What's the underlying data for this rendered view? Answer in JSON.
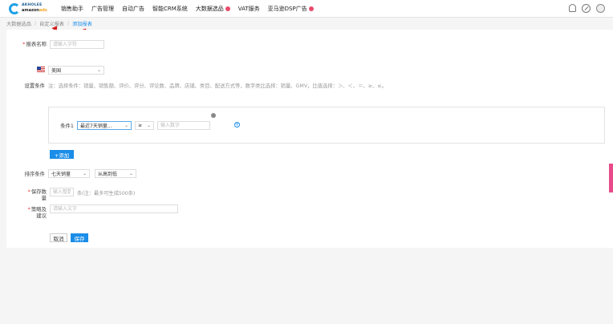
{
  "header": {
    "logo_line1": "AKHOLEE",
    "logo_line2a": "amazon",
    "logo_line2b": "ads",
    "nav": [
      {
        "label": "销售助手",
        "hot": false
      },
      {
        "label": "广告管理",
        "hot": false
      },
      {
        "label": "自动广告",
        "hot": false
      },
      {
        "label": "智能CRM系统",
        "hot": false
      },
      {
        "label": "大数据选品",
        "hot": true
      },
      {
        "label": "VAT服务",
        "hot": false
      },
      {
        "label": "亚马逊DSP广告",
        "hot": true
      }
    ]
  },
  "breadcrumb": {
    "items": [
      "大数据选品",
      "自定义报表",
      "添加报表"
    ]
  },
  "form": {
    "name_label": "报表名称",
    "name_placeholder": "请输入字符",
    "country_value": "美国",
    "conditions_label": "设置条件",
    "conditions_note": "注：选择条件：销量、销售额、评价、评分、评论数、品牌、店铺、类目、配送方式等，数字类比选择：销量、GMV，比值选择：＞、＜、＝、≥、≤。",
    "condition1_label": "条件1",
    "condition1_field": "最近7天销量...",
    "condition1_op": "≥",
    "condition1_placeholder": "输入数字",
    "add_button": "+添加",
    "sort_label": "排序条件",
    "sort_field": "七天销量",
    "sort_order": "从高到低",
    "count_label": "保存数量",
    "count_placeholder": "输入整数",
    "count_hint": "条(注：最多可生成500条)",
    "strategy_label": "策略及建议",
    "strategy_placeholder": "请输入文字",
    "cancel_button": "取消",
    "save_button": "保存"
  },
  "colors": {
    "accent": "#1a8de8",
    "annotation_arrow": "#d41e1e",
    "required": "#e33333"
  }
}
